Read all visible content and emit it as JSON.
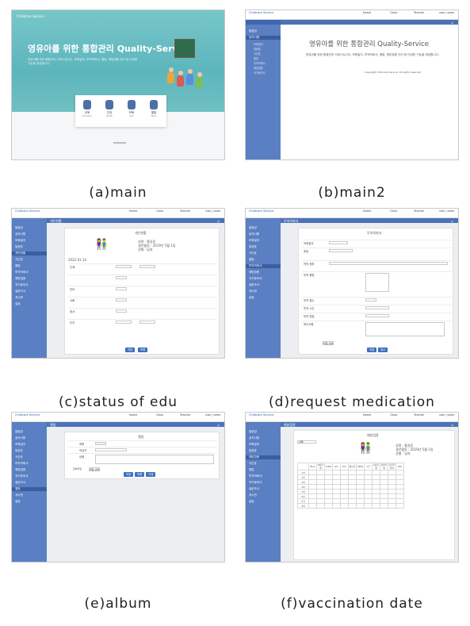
{
  "captions": {
    "a": "(a)main",
    "b": "(b)main2",
    "c": "(c)status of edu",
    "d": "(d)request medication",
    "e": "(e)album",
    "f": "(f)vaccination date"
  },
  "main": {
    "logo": "Childcare Service",
    "headline": "영유아를 위한 통합관리 Quality-Service",
    "description": "영유아를 위한 통합관리 서비스입니다. 보육일지, 투약의뢰서, 앨범, 예방접종 관리 등 다양한 기능을 제공합니다.",
    "cards": [
      {
        "title": "교육",
        "desc": "Education"
      },
      {
        "title": "건강",
        "desc": "Health"
      },
      {
        "title": "보육",
        "desc": "Care"
      },
      {
        "title": "앨범",
        "desc": "Album"
      }
    ]
  },
  "main2": {
    "headline": "영유아를 위한 통합관리 Quality-Service",
    "description": "영유아를 위한 통합관리 서비스입니다. 보육일지, 투약의뢰서, 앨범, 예방접종 관리 등 다양한 기능을 제공합니다.",
    "footer": "Copyright Childcare Service. All rights reserved."
  },
  "shell": {
    "logo": "Childcare Service",
    "top_items": [
      "Name",
      "Class",
      "Teacher",
      "user_name"
    ],
    "menu": [
      "알림장",
      "공지사항",
      "보육일지",
      "일정표",
      "식단표",
      "앨범",
      "투약의뢰서",
      "예방접종",
      "귀가동의서",
      "설문조사",
      "게시판",
      "설정"
    ]
  },
  "edu": {
    "header": "개인현황",
    "form_title": "개인현황",
    "info": [
      "성명 : 홍길동",
      "생년월일 : 2019년 5월 1일",
      "성별 : 남자"
    ],
    "date": "2022.01.14",
    "rows": [
      "신체",
      "언어",
      "사회",
      "정서",
      "인지"
    ],
    "buttons": [
      "저장",
      "목록"
    ]
  },
  "medication": {
    "header": "투약의뢰서",
    "form_title": "투약의뢰서",
    "rows": [
      "의뢰일자",
      "증상",
      "약의 종류",
      "투약 용량",
      "투약 횟수",
      "투약 시간",
      "보관 방법",
      "특이사항"
    ],
    "attach": "파일 선택",
    "buttons": [
      "저장",
      "취소"
    ]
  },
  "album": {
    "header": "앨범",
    "form_title": "앨범",
    "rows": [
      "제목",
      "작성자",
      "내용"
    ],
    "file_label": "첨부파일",
    "attach": "파일 선택",
    "buttons": [
      "저장",
      "목록",
      "삭제"
    ]
  },
  "vaccination": {
    "header": "예방접종",
    "form_title": "예방접종",
    "info": [
      "성명 : 홍길동",
      "생년월일 : 2019년 5월 1일",
      "성별 : 남자"
    ],
    "select": "선택",
    "cols": [
      "BCG",
      "B형간염",
      "DTaP",
      "IPV",
      "Hib",
      "폐구균",
      "MMR",
      "수두",
      "A형간염",
      "일본뇌염",
      "인플루엔자",
      "HPV"
    ],
    "rows": [
      "1차",
      "2차",
      "3차",
      "4차",
      "5차",
      "6차",
      "추가",
      "기타"
    ]
  }
}
